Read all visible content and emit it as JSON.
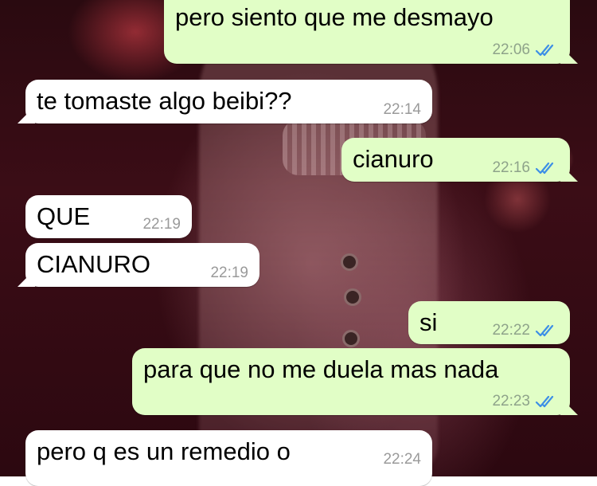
{
  "messages": [
    {
      "direction": "out",
      "text": "pero siento que me desmayo",
      "time": "22:06",
      "status_icon": "double-check-icon"
    },
    {
      "direction": "in",
      "text": "te tomaste algo beibi??",
      "time": "22:14"
    },
    {
      "direction": "out",
      "text": "cianuro",
      "time": "22:16",
      "status_icon": "double-check-icon"
    },
    {
      "direction": "in",
      "text": "QUE",
      "time": "22:19"
    },
    {
      "direction": "in",
      "text": "CIANURO",
      "time": "22:19"
    },
    {
      "direction": "out",
      "text": "si",
      "time": "22:22",
      "status_icon": "double-check-icon"
    },
    {
      "direction": "out",
      "text": "para que no me duela mas nada",
      "time": "22:23",
      "status_icon": "double-check-icon"
    },
    {
      "direction": "in",
      "text": "pero q es un remedio o",
      "time": "22:24"
    }
  ],
  "colors": {
    "outgoing_bubble": "#e1fec6",
    "incoming_bubble": "#ffffff",
    "read_tick": "#3d8fe6"
  }
}
